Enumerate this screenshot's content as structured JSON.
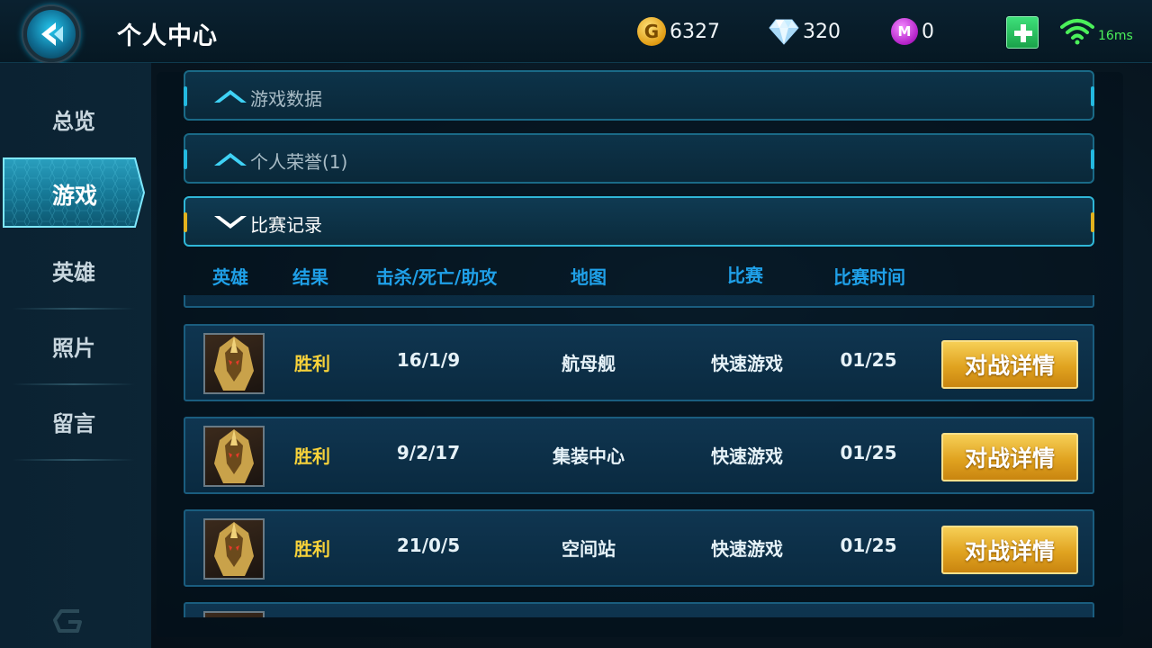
{
  "header": {
    "title": "个人中心",
    "gold": "6327",
    "gold_symbol": "G",
    "diamonds": "320",
    "mcoin": "0",
    "mcoin_symbol": "M",
    "ping": "16ms"
  },
  "sidebar": {
    "items": [
      {
        "label": "总览"
      },
      {
        "label": "游戏"
      },
      {
        "label": "英雄"
      },
      {
        "label": "照片"
      },
      {
        "label": "留言"
      }
    ],
    "active_index": 1
  },
  "sections": {
    "game_data": {
      "label": "游戏数据",
      "expanded": false
    },
    "honors": {
      "label": "个人荣誉(1)",
      "expanded": false
    },
    "match_record": {
      "label": "比赛记录",
      "expanded": true
    }
  },
  "table": {
    "headers": [
      "英雄",
      "结果",
      "击杀/死亡/助攻",
      "地图",
      "比赛",
      "比赛时间"
    ],
    "rows": [
      {
        "result": "胜利",
        "kda": "16/1/9",
        "map": "航母舰",
        "mode": "快速游戏",
        "date": "01/25",
        "action": "对战详情"
      },
      {
        "result": "胜利",
        "kda": "9/2/17",
        "map": "集装中心",
        "mode": "快速游戏",
        "date": "01/25",
        "action": "对战详情"
      },
      {
        "result": "胜利",
        "kda": "21/0/5",
        "map": "空间站",
        "mode": "快速游戏",
        "date": "01/25",
        "action": "对战详情"
      }
    ]
  },
  "colors": {
    "accent_cyan": "#23b9e0",
    "header_blue": "#1fa0e8",
    "win_yellow": "#f7d23a",
    "button_gold": "#e0a320",
    "ping_green": "#4bf05a"
  }
}
